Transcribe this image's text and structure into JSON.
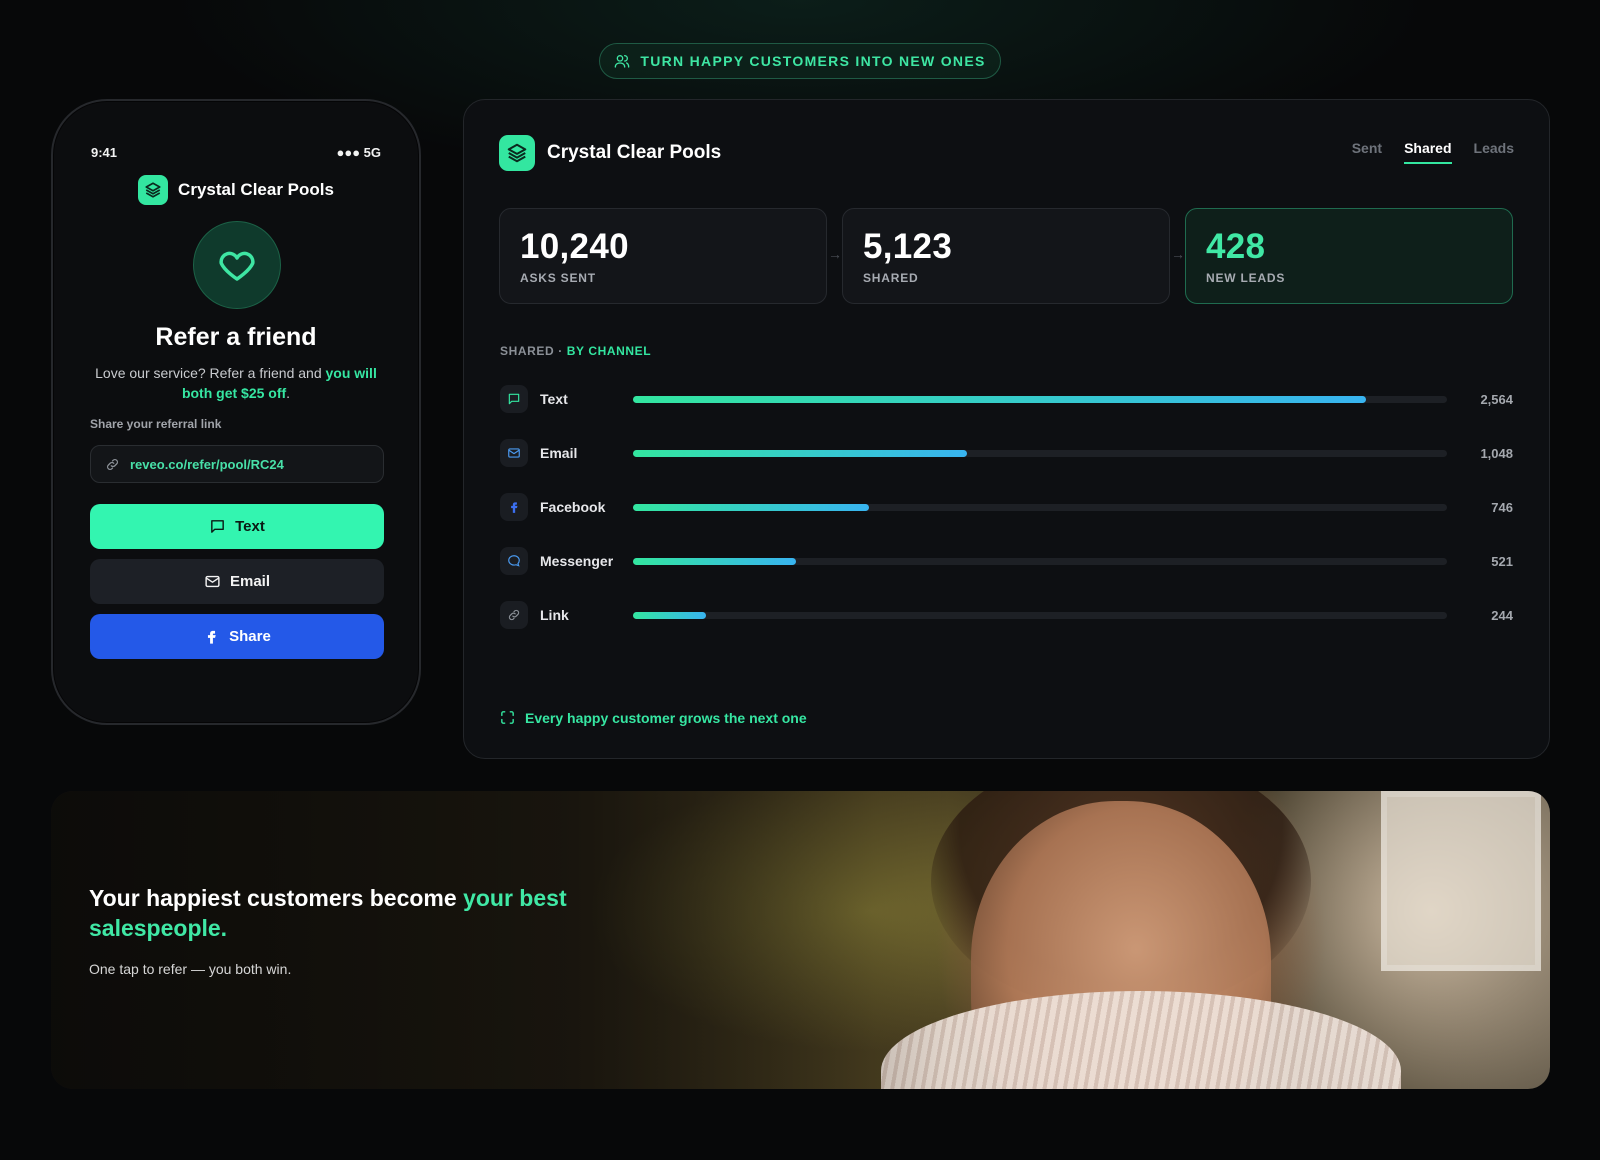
{
  "pill": {
    "text": "TURN HAPPY CUSTOMERS INTO NEW ONES",
    "icon": "users-icon"
  },
  "phone": {
    "time": "9:41",
    "signal": "●●● 5G",
    "brand": "Crystal Clear Pools",
    "title": "Refer a friend",
    "desc_plain": "Love our service? Refer a friend and ",
    "desc_highlight": "you will both get $25 off",
    "desc_end": ".",
    "share_label": "Share your referral link",
    "link": "reveo.co/refer/pool/RC24",
    "buttons": {
      "text": "Text",
      "email": "Email",
      "share": "Share"
    }
  },
  "dashboard": {
    "brand": "Crystal Clear Pools",
    "tabs": [
      {
        "label": "Sent",
        "active": false
      },
      {
        "label": "Shared",
        "active": true
      },
      {
        "label": "Leads",
        "active": false
      }
    ],
    "stats": [
      {
        "value": "10,240",
        "label": "ASKS SENT"
      },
      {
        "value": "5,123",
        "label": "SHARED"
      },
      {
        "value": "428",
        "label": "NEW LEADS"
      }
    ],
    "section_label_a": "SHARED · ",
    "section_label_b": "BY CHANNEL",
    "channels": [
      {
        "name": "Text",
        "value": "2,564",
        "icon": "message-icon",
        "fraction": 0.9
      },
      {
        "name": "Email",
        "value": "1,048",
        "icon": "mail-icon",
        "fraction": 0.41
      },
      {
        "name": "Facebook",
        "value": "746",
        "icon": "facebook-icon",
        "fraction": 0.29
      },
      {
        "name": "Messenger",
        "value": "521",
        "icon": "chat-bubble-icon",
        "fraction": 0.2
      },
      {
        "name": "Link",
        "value": "244",
        "icon": "link-icon",
        "fraction": 0.09
      }
    ],
    "footer": "Every happy customer grows the next one"
  },
  "banner": {
    "title_plain": "Your happiest customers become ",
    "title_highlight": "your best salespeople.",
    "subtitle": "One tap to refer — you both win."
  },
  "colors": {
    "accent": "#33e6a0",
    "facebook_blue": "#2459e8",
    "background": "#070809"
  }
}
